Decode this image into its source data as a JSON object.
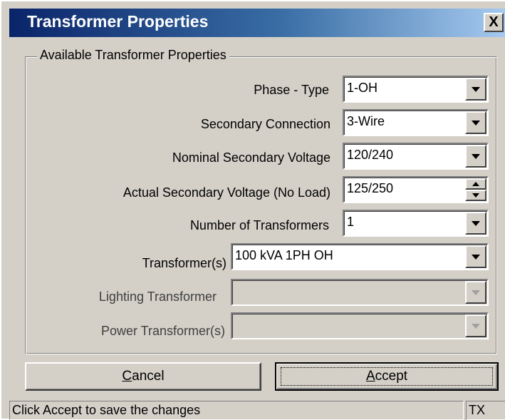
{
  "window": {
    "title": "Transformer Properties",
    "close_glyph": "X"
  },
  "group": {
    "label": "Available Transformer Properties"
  },
  "fields": {
    "phase_type": {
      "label": "Phase - Type",
      "value": "1-OH"
    },
    "secondary_connection": {
      "label": "Secondary Connection",
      "value": "3-Wire"
    },
    "nominal_voltage": {
      "label": "Nominal Secondary Voltage",
      "value": "120/240"
    },
    "actual_voltage": {
      "label": "Actual Secondary Voltage (No Load)",
      "value": "125/250"
    },
    "num_transformers": {
      "label": "Number of Transformers",
      "value": "1"
    },
    "transformers": {
      "label": "Transformer(s)",
      "value": "100 kVA 1PH OH"
    },
    "lighting_transformer": {
      "label": "Lighting Transformer",
      "value": ""
    },
    "power_transformers": {
      "label": "Power Transformer(s)",
      "value": ""
    }
  },
  "buttons": {
    "cancel": {
      "mnemonic": "C",
      "rest": "ancel"
    },
    "accept": {
      "mnemonic": "A",
      "rest": "ccept"
    }
  },
  "status": {
    "message": "Click Accept to save the changes",
    "code": "TX"
  },
  "colors": {
    "title_start": "#0a246a",
    "title_end": "#a6caf0",
    "face": "#d4d0c8"
  }
}
